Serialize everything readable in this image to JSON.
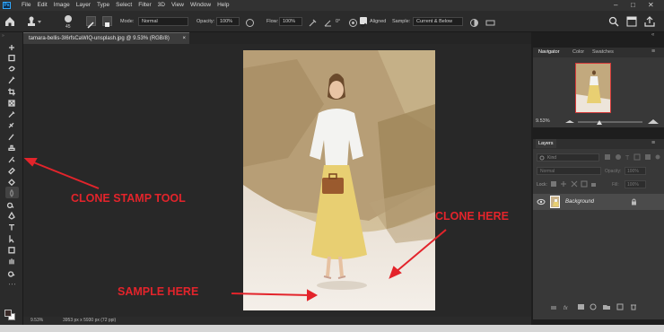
{
  "menu": {
    "logo": "Ps",
    "items": [
      "File",
      "Edit",
      "Image",
      "Layer",
      "Type",
      "Select",
      "Filter",
      "3D",
      "View",
      "Window",
      "Help"
    ],
    "window_controls": [
      "–",
      "□",
      "✕"
    ]
  },
  "options": {
    "brush_size": "45",
    "mode_label": "Mode:",
    "mode_value": "Normal",
    "opacity_label": "Opacity:",
    "opacity_value": "100%",
    "flow_label": "Flow:",
    "flow_value": "100%",
    "angle_value": "0°",
    "aligned_label": "Aligned",
    "sample_label": "Sample:",
    "sample_value": "Current & Below"
  },
  "document": {
    "tab_title": "tamara-bellis-3I6rfsCaWIQ-unsplash.jpg @ 9.53% (RGB/8)",
    "tab_close": "×"
  },
  "status": {
    "zoom": "9.53%",
    "info": "3953 px x 5930 px (72 ppi)"
  },
  "navigator": {
    "tabs": [
      "Navigator",
      "Color",
      "Swatches"
    ],
    "zoom": "9.53%"
  },
  "layers": {
    "tab": "Layers",
    "search_placeholder": "Kind",
    "blend_mode": "Normal",
    "opacity_label": "Opacity:",
    "opacity_value": "100%",
    "lock_label": "Lock:",
    "fill_label": "Fill:",
    "fill_value": "100%",
    "layer_name": "Background"
  },
  "annotations": {
    "clone_stamp": "CLONE STAMP TOOL",
    "clone_here": "CLONE HERE",
    "sample_here": "SAMPLE HERE"
  },
  "colors": {
    "annotation": "#e3242b",
    "accent": "#31a8ff",
    "foreground_swatch": "#3a2a28",
    "background_swatch": "#ffffff"
  },
  "icons": {
    "toolbar": [
      "move-icon",
      "marquee-icon",
      "lasso-icon",
      "quick-select-icon",
      "crop-icon",
      "frame-icon",
      "eyedropper-icon",
      "healing-icon",
      "brush-icon",
      "clone-stamp-icon",
      "history-brush-icon",
      "eraser-icon",
      "paint-bucket-icon",
      "blur-icon",
      "dodge-icon",
      "pen-icon",
      "type-icon",
      "path-select-icon",
      "shape-icon",
      "hand-icon",
      "zoom-icon",
      "more-tools-icon"
    ]
  }
}
